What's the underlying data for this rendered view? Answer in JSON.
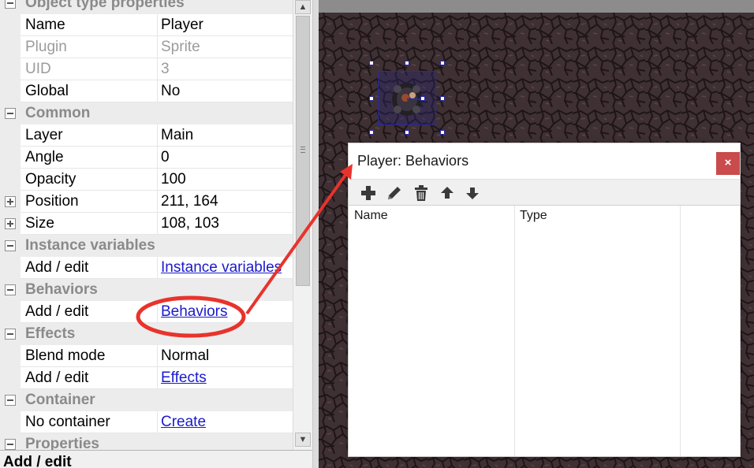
{
  "properties": {
    "rows": [
      {
        "kind": "section",
        "label": "Object type properties",
        "expander": "minus"
      },
      {
        "kind": "prop",
        "label": "Name",
        "value": "Player",
        "value_type": "text",
        "dim": false
      },
      {
        "kind": "prop",
        "label": "Plugin",
        "value": "Sprite",
        "value_type": "readonly",
        "dim": true
      },
      {
        "kind": "prop",
        "label": "UID",
        "value": "3",
        "value_type": "readonly",
        "dim": true
      },
      {
        "kind": "prop",
        "label": "Global",
        "value": "No",
        "value_type": "text",
        "dim": false
      },
      {
        "kind": "section",
        "label": "Common",
        "expander": "minus"
      },
      {
        "kind": "prop",
        "label": "Layer",
        "value": "Main",
        "value_type": "text",
        "dim": false
      },
      {
        "kind": "prop",
        "label": "Angle",
        "value": "0",
        "value_type": "text",
        "dim": false
      },
      {
        "kind": "prop",
        "label": "Opacity",
        "value": "100",
        "value_type": "text",
        "dim": false
      },
      {
        "kind": "prop",
        "label": "Position",
        "value": "211, 164",
        "value_type": "text",
        "dim": false,
        "expander": "plus"
      },
      {
        "kind": "prop",
        "label": "Size",
        "value": "108, 103",
        "value_type": "text",
        "dim": false,
        "expander": "plus"
      },
      {
        "kind": "section",
        "label": "Instance variables",
        "expander": "minus"
      },
      {
        "kind": "prop",
        "label": "Add / edit",
        "value": "Instance variables",
        "value_type": "link",
        "dim": false
      },
      {
        "kind": "section",
        "label": "Behaviors",
        "expander": "minus"
      },
      {
        "kind": "prop",
        "label": "Add / edit",
        "value": "Behaviors",
        "value_type": "link",
        "dim": false
      },
      {
        "kind": "section",
        "label": "Effects",
        "expander": "minus"
      },
      {
        "kind": "prop",
        "label": "Blend mode",
        "value": "Normal",
        "value_type": "text",
        "dim": false
      },
      {
        "kind": "prop",
        "label": "Add / edit",
        "value": "Effects",
        "value_type": "link",
        "dim": false
      },
      {
        "kind": "section",
        "label": "Container",
        "expander": "minus"
      },
      {
        "kind": "prop",
        "label": "No container",
        "value": "Create",
        "value_type": "link",
        "dim": false
      },
      {
        "kind": "section",
        "label": "Properties",
        "expander": "minus"
      }
    ],
    "description_title": "Add / edit"
  },
  "dialog": {
    "title": "Player: Behaviors",
    "close_glyph": "×",
    "toolbar": [
      {
        "name": "add-behavior-icon",
        "tooltip": "Add"
      },
      {
        "name": "edit-behavior-icon",
        "tooltip": "Edit"
      },
      {
        "name": "delete-behavior-icon",
        "tooltip": "Delete"
      },
      {
        "name": "move-up-icon",
        "tooltip": "Move up"
      },
      {
        "name": "move-down-icon",
        "tooltip": "Move down"
      }
    ],
    "columns": [
      "Name",
      "Type"
    ],
    "rows": []
  },
  "colors": {
    "link": "#1a1acc",
    "section_text": "#8a8a8a",
    "annotation_red": "#e8332c",
    "close_button": "#c94b4b",
    "ground": "#3e3033"
  }
}
